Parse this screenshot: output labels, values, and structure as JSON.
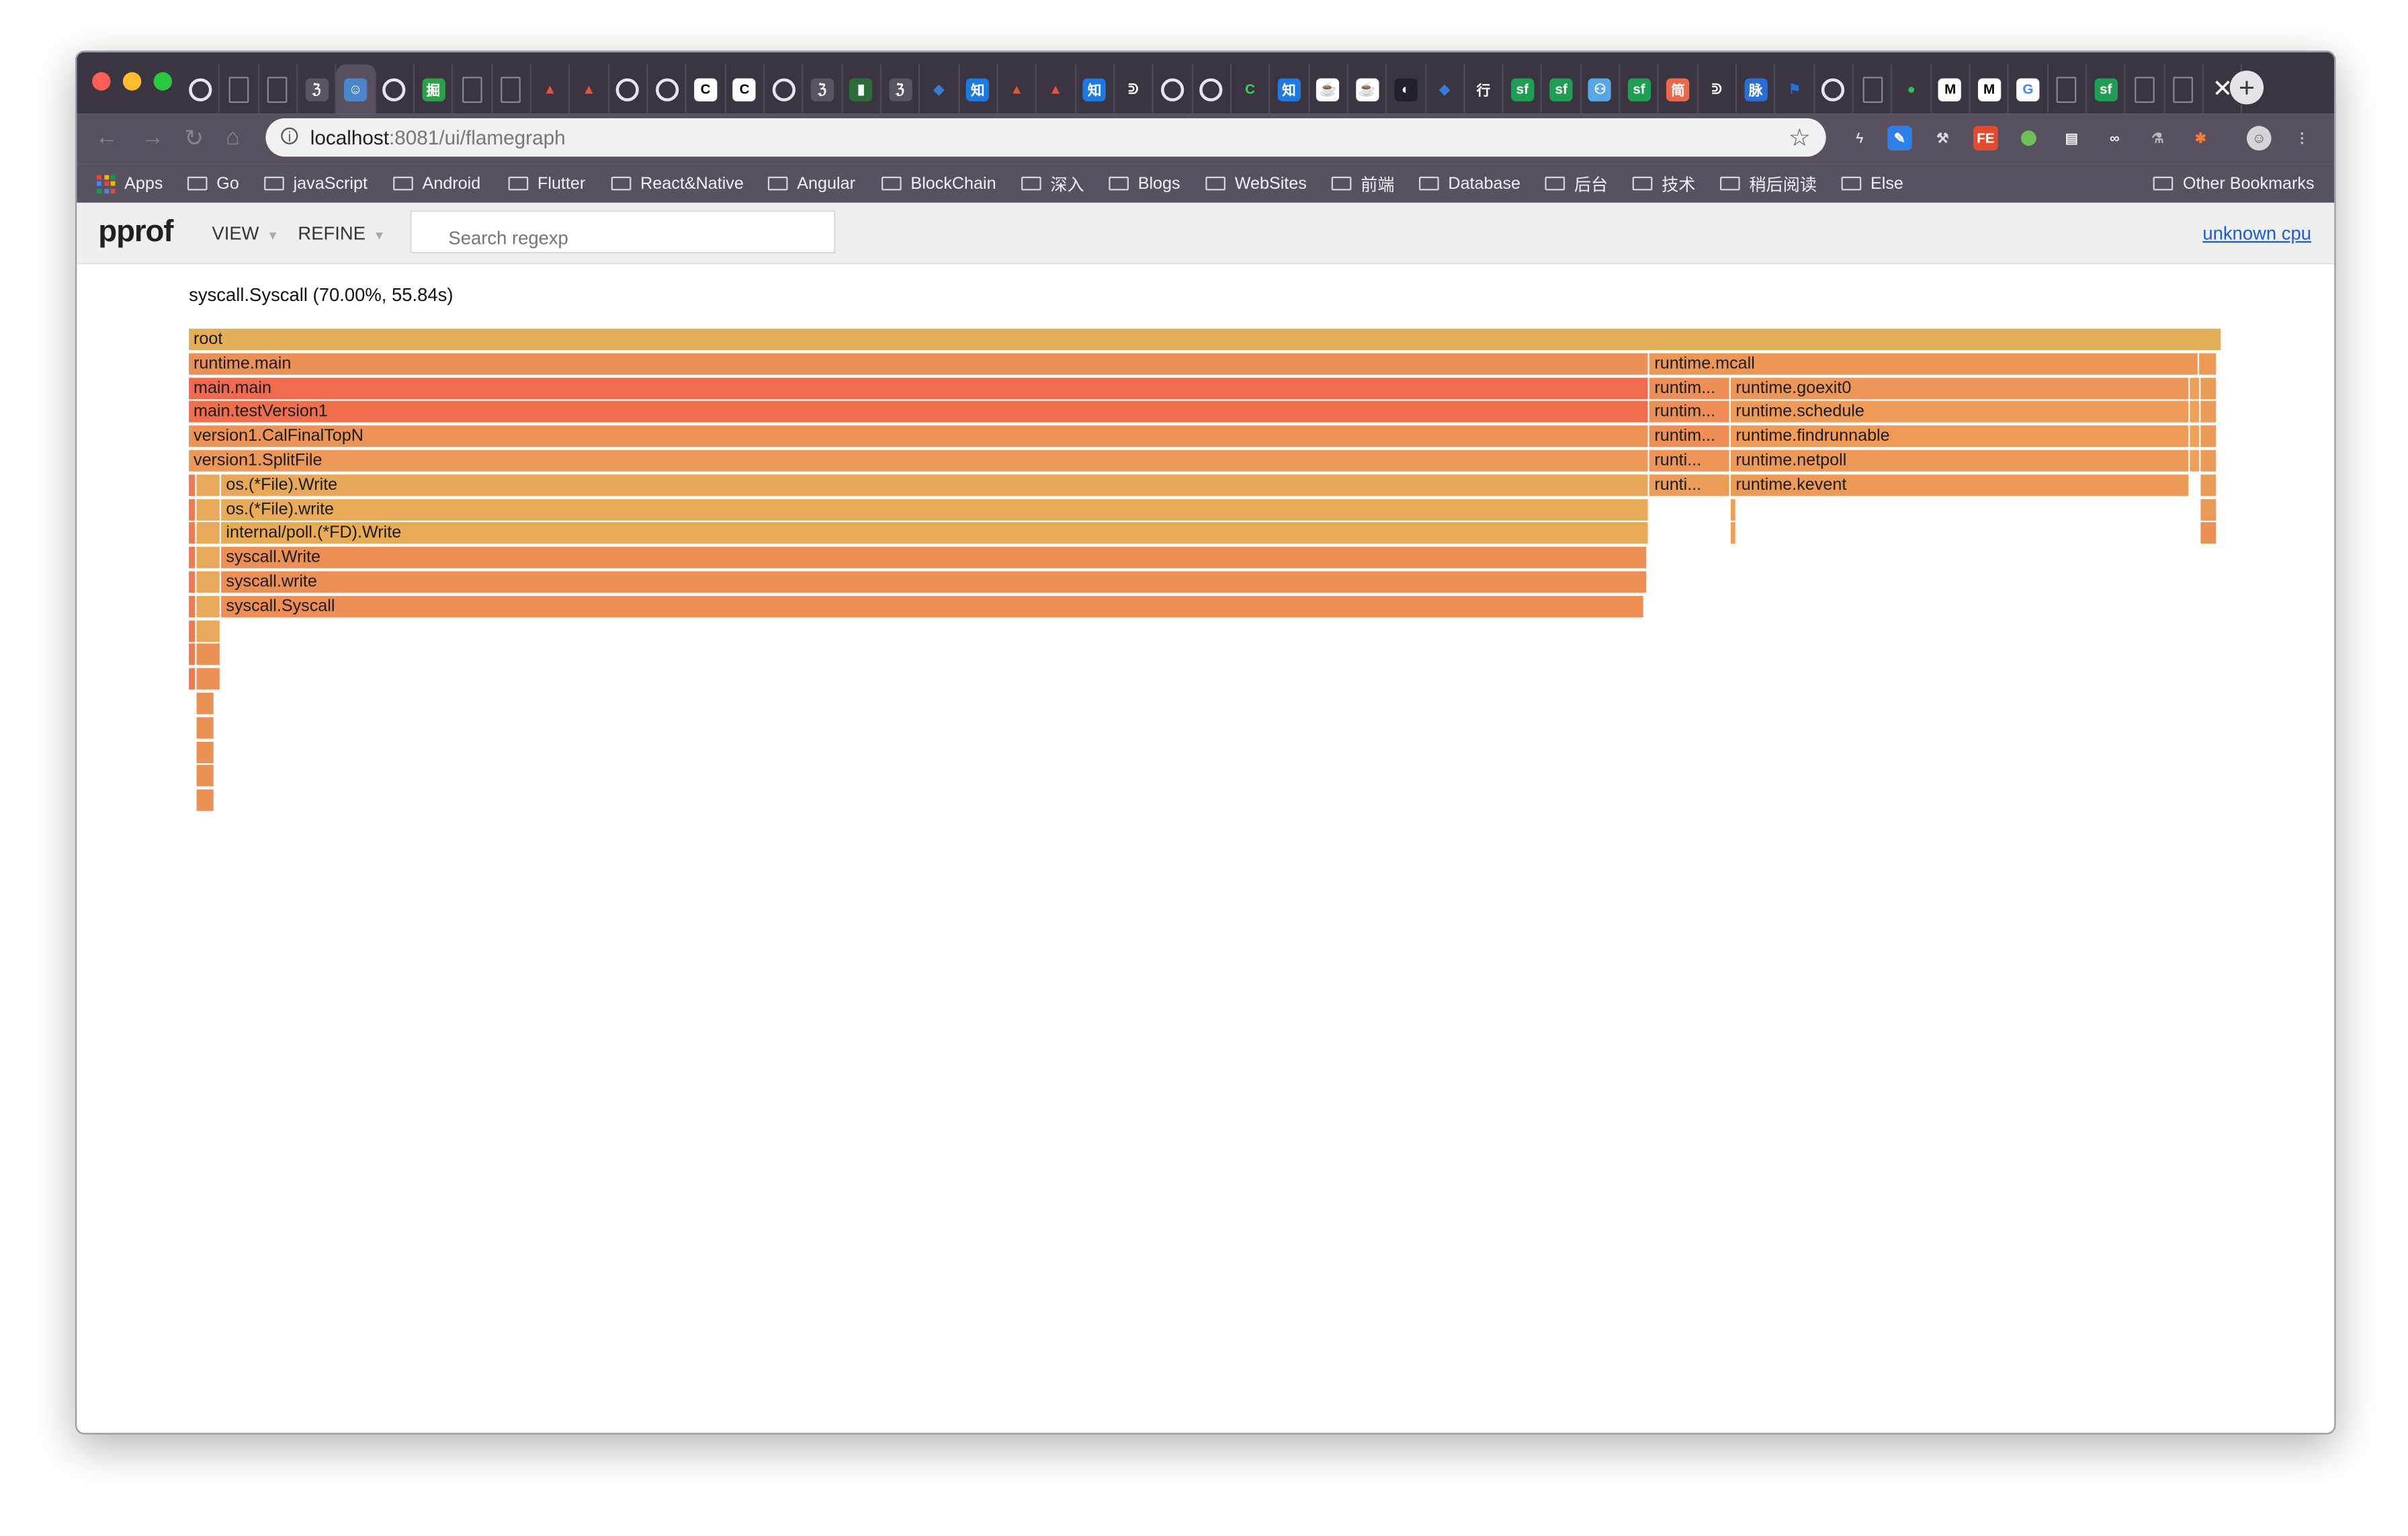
{
  "browser": {
    "tab_icons": [
      {
        "name": "github-icon",
        "bg": "#3b3441",
        "glyph": "◯"
      },
      {
        "name": "page-icon",
        "bg": "#5c5462",
        "glyph": ""
      },
      {
        "name": "page-icon",
        "bg": "#5c5462",
        "glyph": ""
      },
      {
        "name": "script-icon",
        "bg": "#5c5462",
        "glyph": "ℨ"
      },
      {
        "name": "avatar-icon",
        "bg": "#4a86c9",
        "glyph": "☺"
      },
      {
        "name": "github-icon",
        "bg": "#3b3441",
        "glyph": "◯"
      },
      {
        "name": "juejin-icon",
        "bg": "#2f9f4a",
        "glyph": "掘"
      },
      {
        "name": "page-icon",
        "bg": "#5c5462",
        "glyph": ""
      },
      {
        "name": "page-icon",
        "bg": "#5c5462",
        "glyph": ""
      },
      {
        "name": "mountain-icon",
        "bg": "#3b3441",
        "glyph": "▲",
        "fg": "#e2543c"
      },
      {
        "name": "mountain-icon",
        "bg": "#3b3441",
        "glyph": "▲",
        "fg": "#e2543c"
      },
      {
        "name": "github-icon",
        "bg": "#3b3441",
        "glyph": "◯"
      },
      {
        "name": "github-icon",
        "bg": "#3b3441",
        "glyph": "◯"
      },
      {
        "name": "c-icon",
        "bg": "#ffffff",
        "glyph": "C",
        "fg": "#000"
      },
      {
        "name": "c-icon",
        "bg": "#ffffff",
        "glyph": "C",
        "fg": "#000"
      },
      {
        "name": "github-icon",
        "bg": "#3b3441",
        "glyph": "◯"
      },
      {
        "name": "script-icon",
        "bg": "#5c5462",
        "glyph": "ℨ"
      },
      {
        "name": "leaf-icon",
        "bg": "#2c6b3a",
        "glyph": "▮"
      },
      {
        "name": "script-icon",
        "bg": "#5c5462",
        "glyph": "ℨ"
      },
      {
        "name": "diamond-icon",
        "bg": "#3b3441",
        "glyph": "◆",
        "fg": "#3a7bd5"
      },
      {
        "name": "zhihu-icon",
        "bg": "#1e7ae0",
        "glyph": "知"
      },
      {
        "name": "mountain-icon",
        "bg": "#3b3441",
        "glyph": "▲",
        "fg": "#e2543c"
      },
      {
        "name": "mountain-icon",
        "bg": "#3b3441",
        "glyph": "▲",
        "fg": "#e2543c"
      },
      {
        "name": "zhihu-icon",
        "bg": "#1e7ae0",
        "glyph": "知"
      },
      {
        "name": "book-icon",
        "bg": "#3b3441",
        "glyph": "ᕲ"
      },
      {
        "name": "github-icon",
        "bg": "#3b3441",
        "glyph": "◯"
      },
      {
        "name": "github-icon",
        "bg": "#3b3441",
        "glyph": "◯"
      },
      {
        "name": "c-green-icon",
        "bg": "#3b3441",
        "glyph": "C",
        "fg": "#3ecf6b"
      },
      {
        "name": "zhihu-icon",
        "bg": "#1e7ae0",
        "glyph": "知"
      },
      {
        "name": "cup-icon",
        "bg": "#ffffff",
        "glyph": "☕",
        "fg": "#333"
      },
      {
        "name": "cup-icon",
        "bg": "#ffffff",
        "glyph": "☕",
        "fg": "#333"
      },
      {
        "name": "photo-icon",
        "bg": "#23202a",
        "glyph": "◐"
      },
      {
        "name": "diamond-icon",
        "bg": "#3b3441",
        "glyph": "◆",
        "fg": "#3a7bd5"
      },
      {
        "name": "chinese-icon",
        "bg": "#3b3441",
        "glyph": "行"
      },
      {
        "name": "sf-icon",
        "bg": "#1f9e55",
        "glyph": "sf"
      },
      {
        "name": "sf-icon",
        "bg": "#1f9e55",
        "glyph": "sf"
      },
      {
        "name": "robot-icon",
        "bg": "#55a7e6",
        "glyph": "⚇"
      },
      {
        "name": "sf-icon",
        "bg": "#1f9e55",
        "glyph": "sf"
      },
      {
        "name": "jianshu-icon",
        "bg": "#e9694b",
        "glyph": "简"
      },
      {
        "name": "book-icon",
        "bg": "#3b3441",
        "glyph": "ᕲ"
      },
      {
        "name": "mai-icon",
        "bg": "#2a6fd6",
        "glyph": "脉"
      },
      {
        "name": "flag-icon",
        "bg": "#3b3441",
        "glyph": "⚑",
        "fg": "#2a6fd6"
      },
      {
        "name": "github-icon",
        "bg": "#3b3441",
        "glyph": "◯"
      },
      {
        "name": "page-icon",
        "bg": "#5c5462",
        "glyph": ""
      },
      {
        "name": "wechat-icon",
        "bg": "#3b3441",
        "glyph": "●",
        "fg": "#2ac25b"
      },
      {
        "name": "medium-icon",
        "bg": "#ffffff",
        "glyph": "M",
        "fg": "#000"
      },
      {
        "name": "medium-icon",
        "bg": "#ffffff",
        "glyph": "M",
        "fg": "#000"
      },
      {
        "name": "google-icon",
        "bg": "#ffffff",
        "glyph": "G",
        "fg": "#4285f4"
      },
      {
        "name": "page-icon",
        "bg": "#5c5462",
        "glyph": ""
      },
      {
        "name": "sf-icon",
        "bg": "#1f9e55",
        "glyph": "sf"
      },
      {
        "name": "page-icon",
        "bg": "#5c5462",
        "glyph": ""
      },
      {
        "name": "page-icon",
        "bg": "#5c5462",
        "glyph": ""
      }
    ],
    "close_glyph": "✕",
    "newtab_glyph": "+",
    "url_host": "localhost",
    "url_path": ":8081/ui/flamegraph",
    "bookmarks": [
      "Apps",
      "Go",
      "javaScript",
      "Android",
      "Flutter",
      "React&Native",
      "Angular",
      "BlockChain",
      "深入",
      "Blogs",
      "WebSites",
      "前端",
      "Database",
      "后台",
      "技术",
      "稍后阅读",
      "Else"
    ],
    "other_bookmarks": "Other Bookmarks"
  },
  "pprof": {
    "logo": "pprof",
    "view_menu": "VIEW",
    "refine_menu": "REFINE",
    "search_placeholder": "Search regexp",
    "profile_link": "unknown cpu",
    "status": "syscall.Syscall (70.00%, 55.84s)"
  },
  "colors": {
    "root": "#e3ad59",
    "deep_red": "#f06b4b",
    "orange": "#ec9658",
    "light_orange": "#e7a659",
    "accent_link": "#1a5bd6"
  },
  "flamegraph": {
    "frames": [
      {
        "label": "root",
        "depth": 0,
        "start": 0.0,
        "width": 1.0,
        "color": "#e3ad59"
      },
      {
        "label": "runtime.main",
        "depth": 1,
        "start": 0.0,
        "width": 0.7185,
        "color": "#ea9158"
      },
      {
        "label": "runtime.mcall",
        "depth": 1,
        "start": 0.7185,
        "width": 0.27,
        "color": "#ed9757"
      },
      {
        "label": "",
        "depth": 1,
        "start": 0.9885,
        "width": 0.009,
        "color": "#ee9a55"
      },
      {
        "label": "main.main",
        "depth": 2,
        "start": 0.0,
        "width": 0.7185,
        "color": "#f06a4d"
      },
      {
        "label": "runtim...",
        "depth": 2,
        "start": 0.7185,
        "width": 0.04,
        "color": "#ed8f57"
      },
      {
        "label": "runtime.goexit0",
        "depth": 2,
        "start": 0.7585,
        "width": 0.226,
        "color": "#ee9558"
      },
      {
        "label": "",
        "depth": 2,
        "start": 0.9845,
        "width": 0.005,
        "color": "#eea05a"
      },
      {
        "label": "",
        "depth": 2,
        "start": 0.9895,
        "width": 0.008,
        "color": "#ec9a58"
      },
      {
        "label": "main.testVersion1",
        "depth": 3,
        "start": 0.0,
        "width": 0.7185,
        "color": "#f06e4c"
      },
      {
        "label": "runtim...",
        "depth": 3,
        "start": 0.7185,
        "width": 0.04,
        "color": "#ee8e56"
      },
      {
        "label": "runtime.schedule",
        "depth": 3,
        "start": 0.7585,
        "width": 0.226,
        "color": "#ef9a57"
      },
      {
        "label": "",
        "depth": 3,
        "start": 0.9845,
        "width": 0.005,
        "color": "#eea05a"
      },
      {
        "label": "",
        "depth": 3,
        "start": 0.9895,
        "width": 0.008,
        "color": "#ec9a58"
      },
      {
        "label": "version1.CalFinalTopN",
        "depth": 4,
        "start": 0.0,
        "width": 0.7185,
        "color": "#ec9458"
      },
      {
        "label": "runtim...",
        "depth": 4,
        "start": 0.7185,
        "width": 0.04,
        "color": "#ee8f57"
      },
      {
        "label": "runtime.findrunnable",
        "depth": 4,
        "start": 0.7585,
        "width": 0.226,
        "color": "#ef9a56"
      },
      {
        "label": "",
        "depth": 4,
        "start": 0.9845,
        "width": 0.005,
        "color": "#eea05a"
      },
      {
        "label": "",
        "depth": 4,
        "start": 0.9895,
        "width": 0.008,
        "color": "#ec9a58"
      },
      {
        "label": "version1.SplitFile",
        "depth": 5,
        "start": 0.0,
        "width": 0.7185,
        "color": "#ec9858"
      },
      {
        "label": "runti...",
        "depth": 5,
        "start": 0.7185,
        "width": 0.04,
        "color": "#ed9457"
      },
      {
        "label": "runtime.netpoll",
        "depth": 5,
        "start": 0.7585,
        "width": 0.226,
        "color": "#ed9958"
      },
      {
        "label": "",
        "depth": 5,
        "start": 0.9845,
        "width": 0.005,
        "color": "#eea05a"
      },
      {
        "label": "",
        "depth": 5,
        "start": 0.9895,
        "width": 0.008,
        "color": "#ec9a58"
      },
      {
        "label": "",
        "depth": 6,
        "start": 0.0,
        "width": 0.004,
        "color": "#ee7a50"
      },
      {
        "label": "",
        "depth": 6,
        "start": 0.004,
        "width": 0.012,
        "color": "#e8a95a"
      },
      {
        "label": "os.(*File).Write",
        "depth": 6,
        "start": 0.016,
        "width": 0.7025,
        "color": "#e7a85a"
      },
      {
        "label": "runti...",
        "depth": 6,
        "start": 0.7185,
        "width": 0.04,
        "color": "#ec9d58"
      },
      {
        "label": "runtime.kevent",
        "depth": 6,
        "start": 0.7585,
        "width": 0.226,
        "color": "#ee9a57"
      },
      {
        "label": "",
        "depth": 6,
        "start": 0.9895,
        "width": 0.008,
        "color": "#ec9a58"
      },
      {
        "label": "",
        "depth": 7,
        "start": 0.0,
        "width": 0.004,
        "color": "#ee7a50"
      },
      {
        "label": "",
        "depth": 7,
        "start": 0.004,
        "width": 0.012,
        "color": "#e8a95a"
      },
      {
        "label": "os.(*File).write",
        "depth": 7,
        "start": 0.016,
        "width": 0.7025,
        "color": "#e7ab59"
      },
      {
        "label": "",
        "depth": 7,
        "start": 0.7585,
        "width": 0.0015,
        "color": "#eea05a"
      },
      {
        "label": "",
        "depth": 7,
        "start": 0.9895,
        "width": 0.008,
        "color": "#ec9a58"
      },
      {
        "label": "",
        "depth": 8,
        "start": 0.0,
        "width": 0.004,
        "color": "#ee7a50"
      },
      {
        "label": "",
        "depth": 8,
        "start": 0.004,
        "width": 0.012,
        "color": "#e8a95a"
      },
      {
        "label": "internal/poll.(*FD).Write",
        "depth": 8,
        "start": 0.016,
        "width": 0.7025,
        "color": "#e7ab58"
      },
      {
        "label": "",
        "depth": 8,
        "start": 0.7585,
        "width": 0.0015,
        "color": "#eea05a"
      },
      {
        "label": "",
        "depth": 8,
        "start": 0.9895,
        "width": 0.008,
        "color": "#ec8f52"
      },
      {
        "label": "",
        "depth": 9,
        "start": 0.0,
        "width": 0.004,
        "color": "#ee7a50"
      },
      {
        "label": "",
        "depth": 9,
        "start": 0.004,
        "width": 0.012,
        "color": "#e8a95a"
      },
      {
        "label": "syscall.Write",
        "depth": 9,
        "start": 0.016,
        "width": 0.7015,
        "color": "#ec8f55"
      },
      {
        "label": "",
        "depth": 10,
        "start": 0.0,
        "width": 0.004,
        "color": "#ee7a50"
      },
      {
        "label": "",
        "depth": 10,
        "start": 0.004,
        "width": 0.012,
        "color": "#e8a95a"
      },
      {
        "label": "syscall.write",
        "depth": 10,
        "start": 0.016,
        "width": 0.7015,
        "color": "#ec8f55"
      },
      {
        "label": "",
        "depth": 11,
        "start": 0.0,
        "width": 0.004,
        "color": "#ee7a50"
      },
      {
        "label": "",
        "depth": 11,
        "start": 0.004,
        "width": 0.012,
        "color": "#e8a95a"
      },
      {
        "label": "syscall.Syscall",
        "depth": 11,
        "start": 0.016,
        "width": 0.7,
        "color": "#ee8e54"
      },
      {
        "label": "",
        "depth": 12,
        "start": 0.0,
        "width": 0.004,
        "color": "#ee7a50"
      },
      {
        "label": "",
        "depth": 12,
        "start": 0.004,
        "width": 0.012,
        "color": "#e8a95a"
      },
      {
        "label": "",
        "depth": 13,
        "start": 0.0,
        "width": 0.004,
        "color": "#ee7a50"
      },
      {
        "label": "",
        "depth": 13,
        "start": 0.004,
        "width": 0.012,
        "color": "#ec9155"
      },
      {
        "label": "",
        "depth": 14,
        "start": 0.0,
        "width": 0.004,
        "color": "#ee7a50"
      },
      {
        "label": "",
        "depth": 14,
        "start": 0.004,
        "width": 0.012,
        "color": "#ec9155"
      },
      {
        "label": "",
        "depth": 15,
        "start": 0.004,
        "width": 0.009,
        "color": "#ec9155"
      },
      {
        "label": "",
        "depth": 16,
        "start": 0.004,
        "width": 0.009,
        "color": "#ec9155"
      },
      {
        "label": "",
        "depth": 17,
        "start": 0.004,
        "width": 0.009,
        "color": "#ec9155"
      },
      {
        "label": "",
        "depth": 18,
        "start": 0.004,
        "width": 0.009,
        "color": "#ec9155"
      },
      {
        "label": "",
        "depth": 19,
        "start": 0.004,
        "width": 0.009,
        "color": "#ec9155"
      }
    ]
  }
}
